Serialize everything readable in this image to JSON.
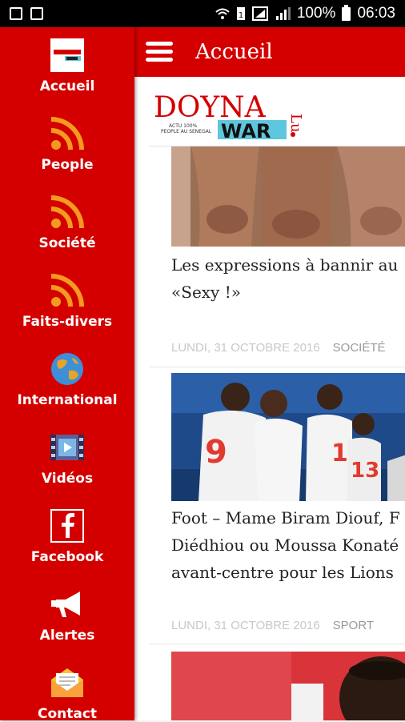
{
  "status_bar": {
    "battery_text": "100%",
    "time": "06:03"
  },
  "toolbar": {
    "title": "Accueil",
    "menu_icon": "hamburger-menu-icon"
  },
  "logo": {
    "main": "DOYNA",
    "second": "WAR",
    "tagline_1": "ACTU 100%",
    "tagline_2": "PEOPLE AU SENEGAL",
    "side": "Lu"
  },
  "drawer": {
    "items": [
      {
        "label": "Accueil",
        "icon": "app-logo-icon"
      },
      {
        "label": "People",
        "icon": "rss-icon"
      },
      {
        "label": "Société",
        "icon": "rss-icon"
      },
      {
        "label": "Faits-divers",
        "icon": "rss-icon"
      },
      {
        "label": "International",
        "icon": "globe-icon"
      },
      {
        "label": "Vidéos",
        "icon": "video-icon"
      },
      {
        "label": "Facebook",
        "icon": "facebook-icon"
      },
      {
        "label": "Alertes",
        "icon": "megaphone-icon"
      },
      {
        "label": "Contact",
        "icon": "envelope-icon"
      }
    ]
  },
  "articles": [
    {
      "title_lines": [
        "Les expressions à bannir au",
        "«Sexy !»"
      ],
      "date": "LUNDI, 31 OCTOBRE 2016",
      "category": "SOCIÉTÉ"
    },
    {
      "title_lines": [
        "Foot – Mame Biram Diouf, F",
        "Diédhiou ou Moussa Konaté",
        "avant-centre pour les Lions"
      ],
      "date": "LUNDI, 31 OCTOBRE 2016",
      "category": "SPORT"
    }
  ],
  "colors": {
    "brand_red": "#d40000",
    "rss_orange": "#f39a1f",
    "meta_grey": "#c8c8c8"
  }
}
